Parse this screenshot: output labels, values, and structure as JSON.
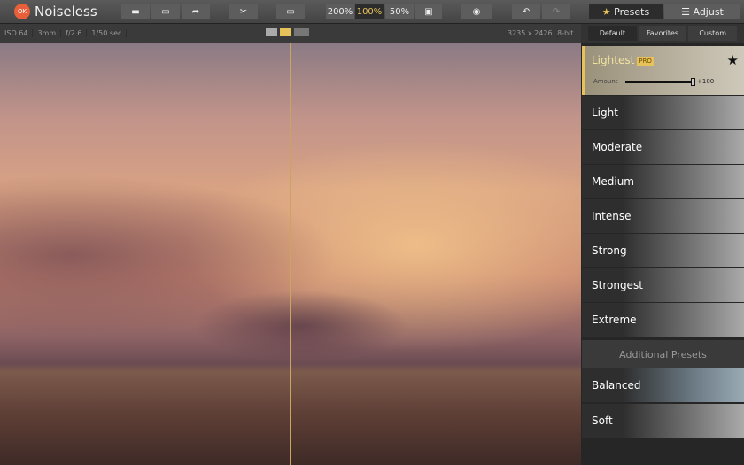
{
  "app": {
    "title": "Noiseless",
    "logo_text": "OK"
  },
  "toolbar": {
    "zoom_options": [
      "200%",
      "100%",
      "50%"
    ],
    "active_zoom": "100%",
    "presets_label": "Presets",
    "adjust_label": "Adjust",
    "accent": "#e7c25a"
  },
  "info": {
    "iso": "ISO 64",
    "focal": "3mm",
    "aperture": "f/2.6",
    "shutter": "1/50 sec",
    "dimensions": "3235 x 2426",
    "bitdepth": "8-bit"
  },
  "sidebar": {
    "tabs": [
      "Default",
      "Favorites",
      "Custom"
    ],
    "active_tab": "Default",
    "selected": {
      "name": "Lightest",
      "badge": "PRO",
      "amount_label": "Amount",
      "amount_value": "+100",
      "amount": 1.0
    },
    "presets": [
      "Light",
      "Moderate",
      "Medium",
      "Intense",
      "Strong",
      "Strongest",
      "Extreme"
    ],
    "additional_header": "Additional Presets",
    "additional": [
      "Balanced",
      "Soft"
    ]
  }
}
